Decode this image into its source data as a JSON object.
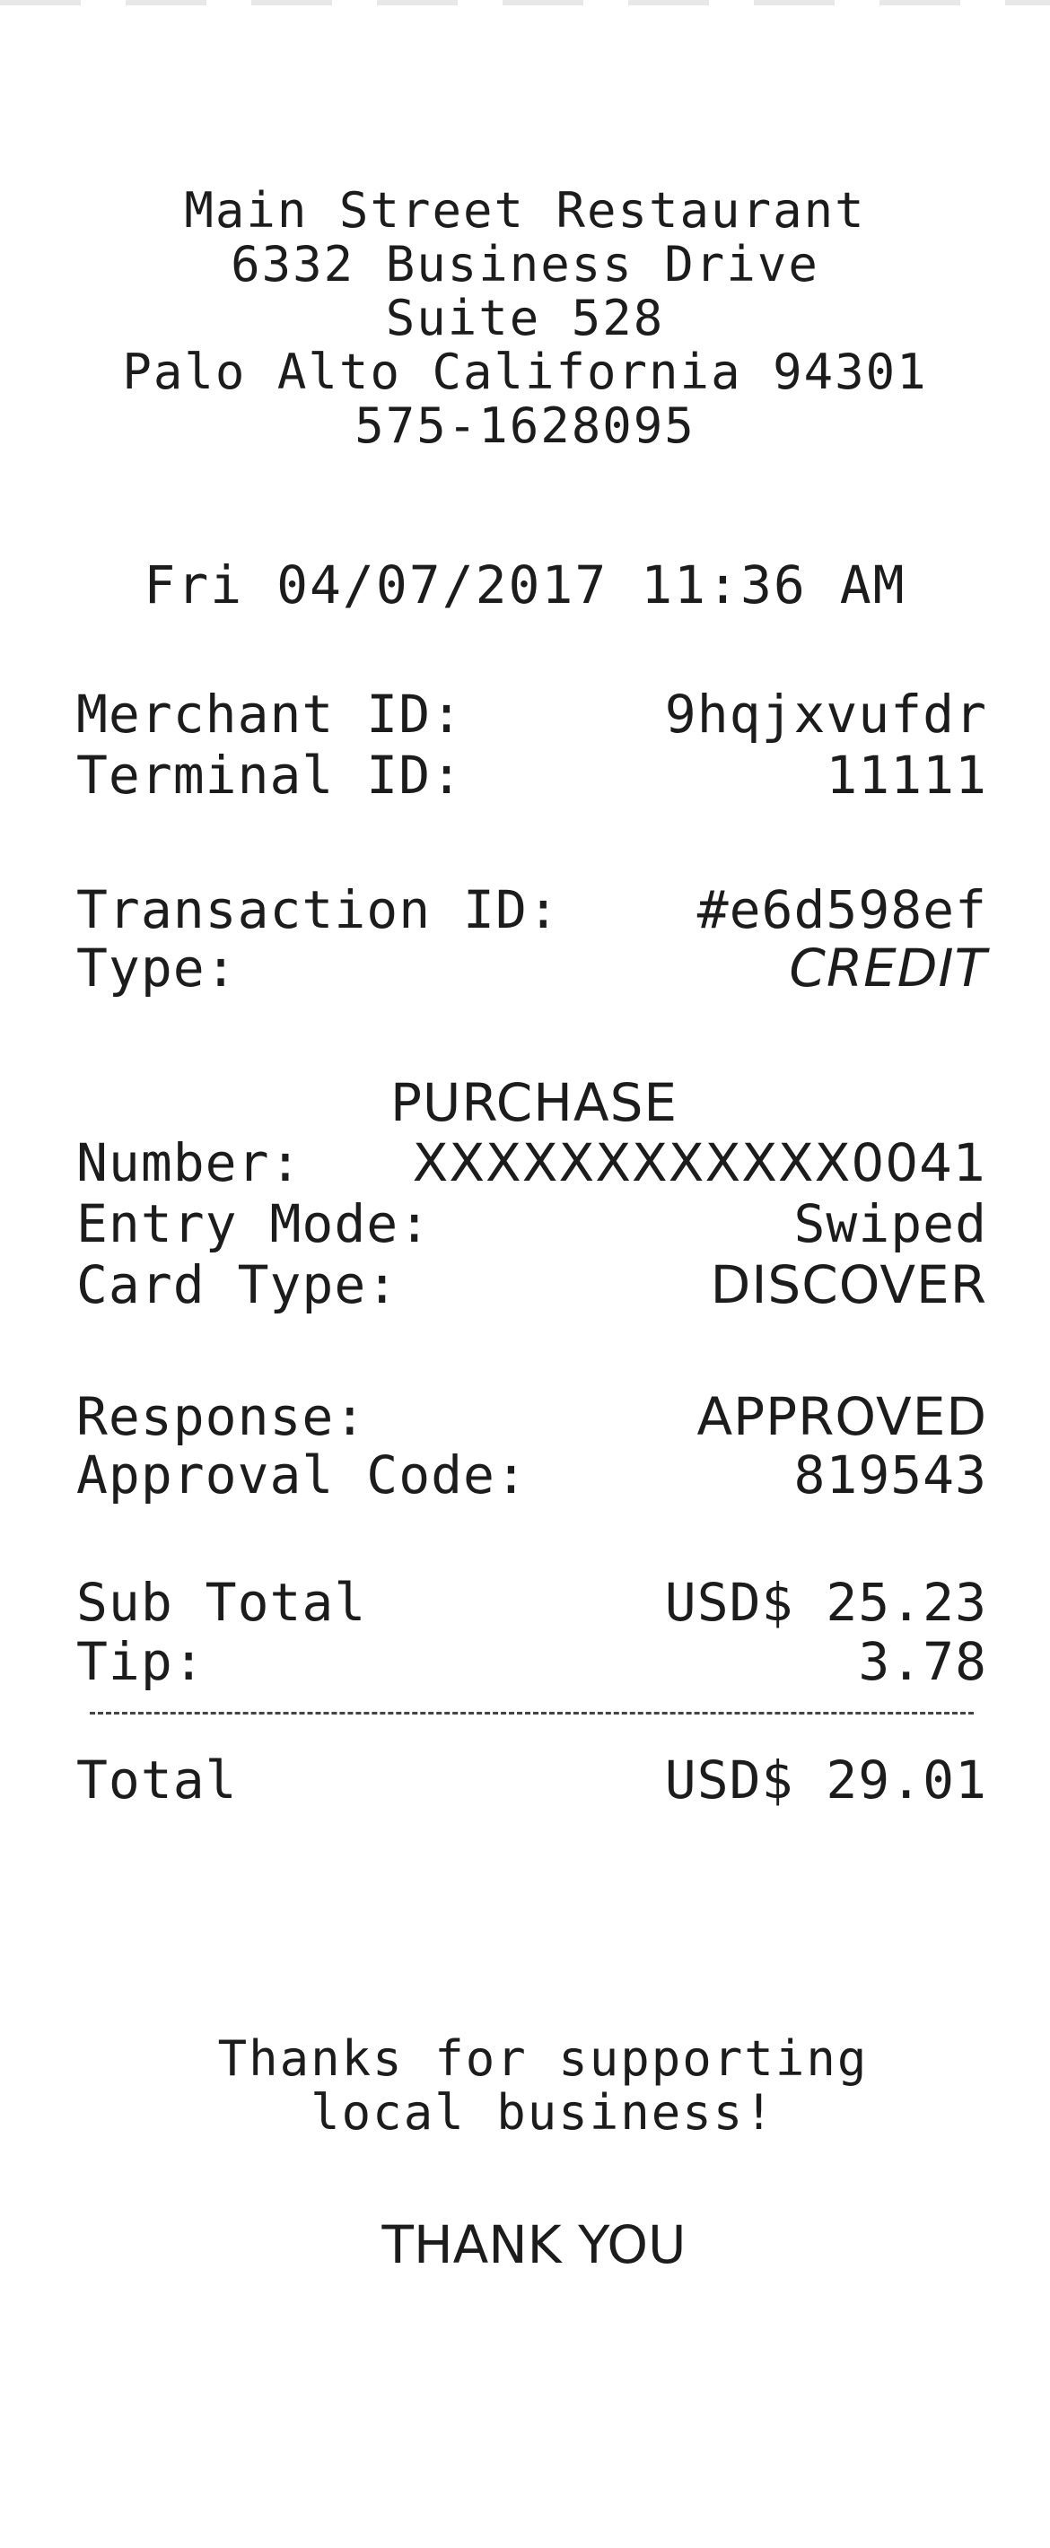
{
  "merchant": {
    "name": "Main Street Restaurant",
    "address_line1": "6332 Business Drive",
    "address_line2": "Suite 528",
    "city_line": "Palo Alto California 94301",
    "phone": "575-1628095"
  },
  "datetime": "Fri 04/07/2017 11:36 AM",
  "ids": {
    "merchant_id_label": "Merchant ID:",
    "merchant_id": "9hqjxvufdr",
    "terminal_id_label": "Terminal ID:",
    "terminal_id": "11111"
  },
  "transaction": {
    "transaction_id_label": "Transaction ID:",
    "transaction_id": "#e6d598ef",
    "type_label": "Type:",
    "type": "CREDIT"
  },
  "purchase": {
    "title": "PURCHASE",
    "number_label": "Number:",
    "number": "XXXXXXXXXXXX0041",
    "entry_mode_label": "Entry Mode:",
    "entry_mode": "Swiped",
    "card_type_label": "Card Type:",
    "card_type": "DISCOVER"
  },
  "response": {
    "response_label": "Response:",
    "response": "APPROVED",
    "approval_code_label": "Approval Code:",
    "approval_code": "819543"
  },
  "totals": {
    "subtotal_label": "Sub Total",
    "subtotal": "USD$ 25.23",
    "tip_label": "Tip:",
    "tip": "3.78",
    "total_label": "Total",
    "total": "USD$ 29.01"
  },
  "footer": {
    "thanks_line1": "Thanks for supporting",
    "thanks_line2": "local business!",
    "thank_you": "THANK YOU"
  }
}
